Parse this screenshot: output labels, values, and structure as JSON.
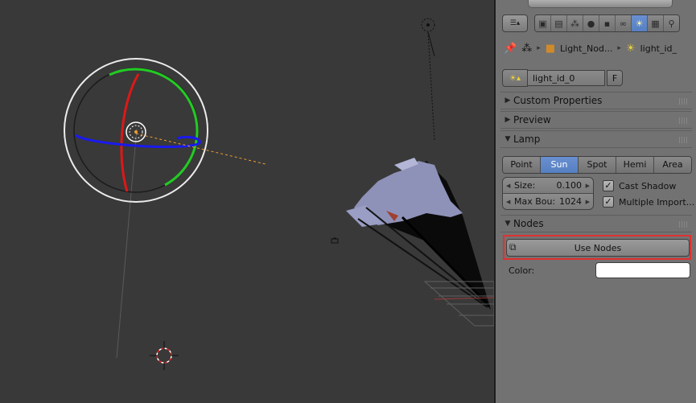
{
  "context_tabs": {
    "icons": [
      "render-icon",
      "render-layers-icon",
      "scene-icon",
      "world-icon",
      "object-icon",
      "constraints-icon",
      "lamp-data-icon",
      "texture-icon",
      "particles-icon"
    ],
    "active_index": 6
  },
  "breadcrumb": {
    "object_name": "Light_Nod...",
    "data_name": "light_id_"
  },
  "datablock": {
    "name": "light_id_0",
    "fake_user_label": "F"
  },
  "panels": {
    "custom_properties": "Custom Properties",
    "preview": "Preview",
    "lamp": "Lamp",
    "nodes": "Nodes"
  },
  "lamp_types": [
    "Point",
    "Sun",
    "Spot",
    "Hemi",
    "Area"
  ],
  "lamp_type_active": "Sun",
  "size": {
    "label": "Size:",
    "value": "0.100"
  },
  "max_bounces": {
    "label": "Max Bou:",
    "value": "1024"
  },
  "cast_shadow": {
    "label": "Cast Shadow",
    "checked": true
  },
  "multiple_importance": {
    "label": "Multiple Import...",
    "checked": true
  },
  "use_nodes_label": "Use Nodes",
  "color": {
    "label": "Color:",
    "value": "#ffffff"
  },
  "colors": {
    "accent": "#5680c2",
    "highlight": "#e03030",
    "viewport_bg": "#393939",
    "panel_bg": "#727272"
  }
}
